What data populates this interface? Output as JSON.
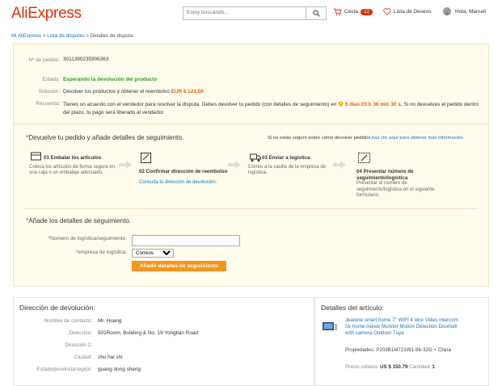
{
  "header": {
    "logo": "AliExpress",
    "search_placeholder": "Estoy buscando...",
    "cart_label": "Cesta",
    "cart_count": "12",
    "wishlist_label": "Lista de Deseos",
    "user_greeting": "Hola, Manuel"
  },
  "breadcrumb": {
    "my_aliexpress": "Mi AliExpress",
    "dispute_list": "Lista de disputas",
    "sep1": ">",
    "sep2": ">",
    "current": "Detalles de disputa"
  },
  "dispute": {
    "order_label": "Nº de pedido:",
    "order_no": "3011390235906363",
    "status_label": "Estado:",
    "status_value": "Esperando la devolución del producto",
    "solution_label": "Solución:",
    "solution_text": "Devolver los productos y obtener el reembolso",
    "refund_amount": "EUR € 121,59",
    "reminder_label": "Recuerda:",
    "reminder_text_1": "Tienes un acuerdo con el vendedor para resolver la disputa. Debes devolver tu pedido (con detalles de seguimiento) en",
    "countdown": "5 días 23 h 36 min 30 s",
    "reminder_text_2": ", Si no devuelves el",
    "reminder_text_3": "pedido dentro del plazo, tu pago será liberado al vendedor."
  },
  "return_section": {
    "title": "Devuelve tu pedido y añade detalles de seguimiento.",
    "help_text": "Si no estás seguro sobre cómo devolver pedidos,",
    "help_link": "haz clic aquí para obtener más información.",
    "steps": [
      {
        "title": "01 Embalar los artículos",
        "desc": "Coloca los artículos de forma segura en una caja o un embalaje adecuado."
      },
      {
        "title": "02 Confirmar dirección de reembolso",
        "link": "Consulta tu dirección de devolución."
      },
      {
        "title": "03 Enviar a logística",
        "desc": "Correo a la casilla de la empresa de logística."
      },
      {
        "title": "04 Presentar número de seguimiento/logística",
        "desc": "Presentar el número de seguimiento/logística en el siguiente formulario."
      }
    ]
  },
  "tracking_form": {
    "title": "Añade los detalles de seguimiento.",
    "tracking_label": "Número de logística/seguimiento:",
    "tracking_value": "",
    "company_label": "empresa de logística:",
    "company_selected": "Correos",
    "submit_label": "Añadir detalles de seguimiento"
  },
  "return_address": {
    "title": "Dirección de devolución:",
    "fields": [
      {
        "label": "Nombre de contacto:",
        "value": "Mr. Huang"
      },
      {
        "label": "Dirección:",
        "value": "501Room, Building & No. 19 Yongtian Road"
      },
      {
        "label": "Dirección 2:",
        "value": ""
      },
      {
        "label": "Ciudad:",
        "value": "zhu hai shi"
      },
      {
        "label": "Estado/provincia/región:",
        "value": "guang dong sheng"
      }
    ]
  },
  "item_details": {
    "title": "Detalles del artículo:",
    "product_title": "Jeatone smart home 7'' WIFI 4 wire Video intercom for home indoor Monitor Motion Detection Doorbell with camera Outdoor Tuya",
    "properties_label": "Propiedades:",
    "properties_value": "P203B1M721W1-86-32G + China",
    "unit_price_label": "Precio unitario:",
    "unit_price_value": "US $ 150.79",
    "quantity_label": "Cantidad:",
    "quantity_value": "1"
  },
  "colors": {
    "brand": "#e62e04",
    "link": "#1a73b8",
    "status_green": "#2e9a2e",
    "accent_orange": "#f05b0a",
    "button_orange": "#f7941d",
    "panel_bg": "#fffcee"
  }
}
